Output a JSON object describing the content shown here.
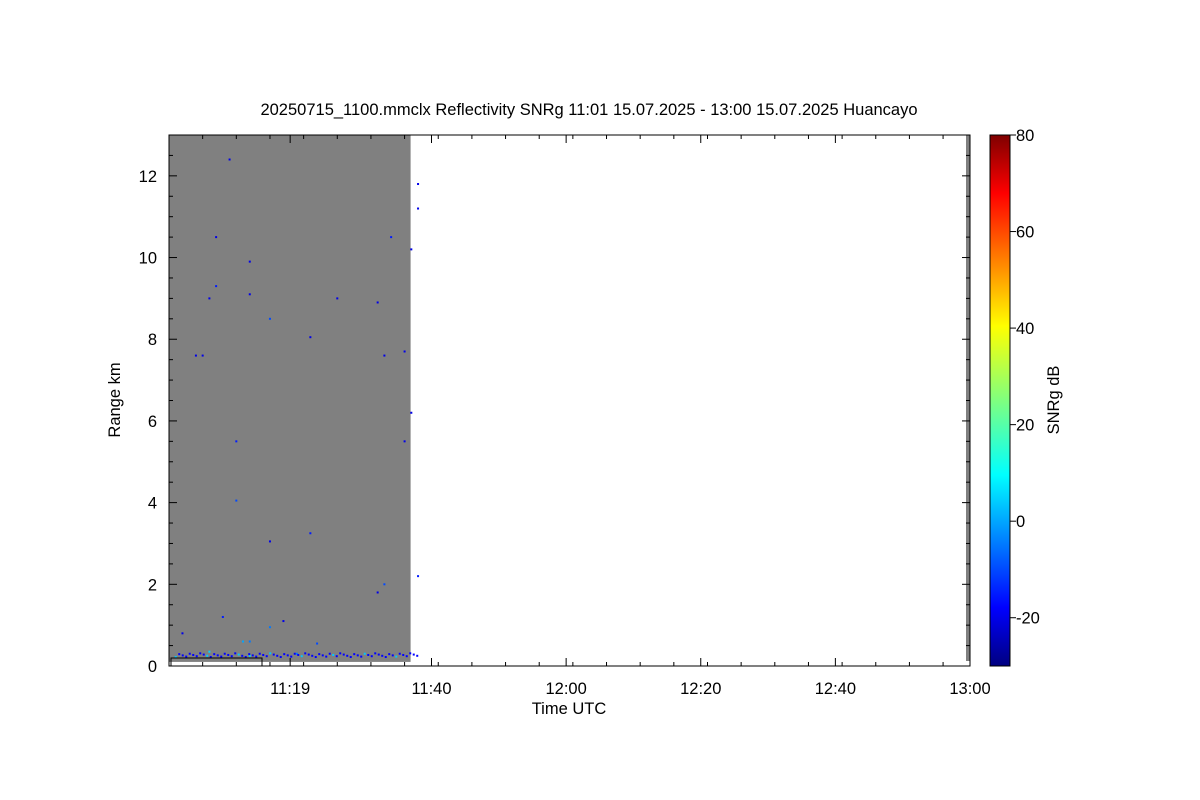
{
  "chart_data": {
    "type": "heatmap",
    "title": "20250715_1100.mmclx Reflectivity SNRg   11:01 15.07.2025 - 13:00 15.07.2025 Huancayo",
    "xlabel": "Time UTC",
    "ylabel": "Range km",
    "x_range": [
      "11:01",
      "13:00"
    ],
    "y_range": [
      0,
      13
    ],
    "x_ticks": [
      "11:19",
      "11:40",
      "12:00",
      "12:20",
      "12:40",
      "13:00"
    ],
    "y_ticks": [
      "0",
      "2",
      "4",
      "6",
      "8",
      "10",
      "12"
    ],
    "data_extent": {
      "time_start": "11:01",
      "time_end": "11:36",
      "range_min_km": 0.1,
      "range_max_km": 13
    },
    "background_color": "#808080",
    "colorbar": {
      "label": "SNRg dB",
      "min": -30,
      "max": 80,
      "ticks": [
        "-20",
        "0",
        "20",
        "40",
        "60",
        "80"
      ],
      "colormap": "jet"
    },
    "sample_points": [
      {
        "t_min": 2,
        "range_km": 0.8,
        "snr_db": -20
      },
      {
        "t_min": 4,
        "range_km": 7.6,
        "snr_db": -20
      },
      {
        "t_min": 5,
        "range_km": 7.6,
        "snr_db": -20
      },
      {
        "t_min": 6,
        "range_km": 9.0,
        "snr_db": -20
      },
      {
        "t_min": 7,
        "range_km": 10.5,
        "snr_db": -20
      },
      {
        "t_min": 7,
        "range_km": 9.3,
        "snr_db": -15
      },
      {
        "t_min": 8,
        "range_km": 1.2,
        "snr_db": -15
      },
      {
        "t_min": 9,
        "range_km": 12.4,
        "snr_db": -20
      },
      {
        "t_min": 10,
        "range_km": 4.05,
        "snr_db": -10
      },
      {
        "t_min": 10,
        "range_km": 5.5,
        "snr_db": -15
      },
      {
        "t_min": 12,
        "range_km": 9.1,
        "snr_db": -20
      },
      {
        "t_min": 12,
        "range_km": 9.9,
        "snr_db": -20
      },
      {
        "t_min": 15,
        "range_km": 8.5,
        "snr_db": -10
      },
      {
        "t_min": 15,
        "range_km": 3.05,
        "snr_db": -20
      },
      {
        "t_min": 17,
        "range_km": 1.1,
        "snr_db": -20
      },
      {
        "t_min": 21,
        "range_km": 3.25,
        "snr_db": -15
      },
      {
        "t_min": 21,
        "range_km": 8.05,
        "snr_db": -20
      },
      {
        "t_min": 25,
        "range_km": 9.0,
        "snr_db": -20
      },
      {
        "t_min": 31,
        "range_km": 8.9,
        "snr_db": -20
      },
      {
        "t_min": 31,
        "range_km": 1.8,
        "snr_db": -20
      },
      {
        "t_min": 32,
        "range_km": 2.0,
        "snr_db": -10
      },
      {
        "t_min": 32,
        "range_km": 7.6,
        "snr_db": -20
      },
      {
        "t_min": 33,
        "range_km": 10.5,
        "snr_db": -15
      },
      {
        "t_min": 35,
        "range_km": 7.7,
        "snr_db": -20
      },
      {
        "t_min": 35,
        "range_km": 5.5,
        "snr_db": -20
      },
      {
        "t_min": 36,
        "range_km": 10.2,
        "snr_db": -20
      },
      {
        "t_min": 36,
        "range_km": 6.2,
        "snr_db": -20
      },
      {
        "t_min": 37,
        "range_km": 11.2,
        "snr_db": -20
      },
      {
        "t_min": 37,
        "range_km": 11.8,
        "snr_db": -20
      },
      {
        "t_min": 37,
        "range_km": 2.2,
        "snr_db": -15
      },
      {
        "t_min": 6,
        "range_km": 0.35,
        "snr_db": 5
      },
      {
        "t_min": 11,
        "range_km": 0.6,
        "snr_db": 0
      },
      {
        "t_min": 12,
        "range_km": 0.6,
        "snr_db": -5
      },
      {
        "t_min": 15,
        "range_km": 0.95,
        "snr_db": -5
      },
      {
        "t_min": 22,
        "range_km": 0.55,
        "snr_db": -10
      },
      {
        "t_min": 12,
        "range_km": 0.25,
        "snr_db": 5
      },
      {
        "t_min": 19,
        "range_km": 0.3,
        "snr_db": -5
      }
    ]
  }
}
